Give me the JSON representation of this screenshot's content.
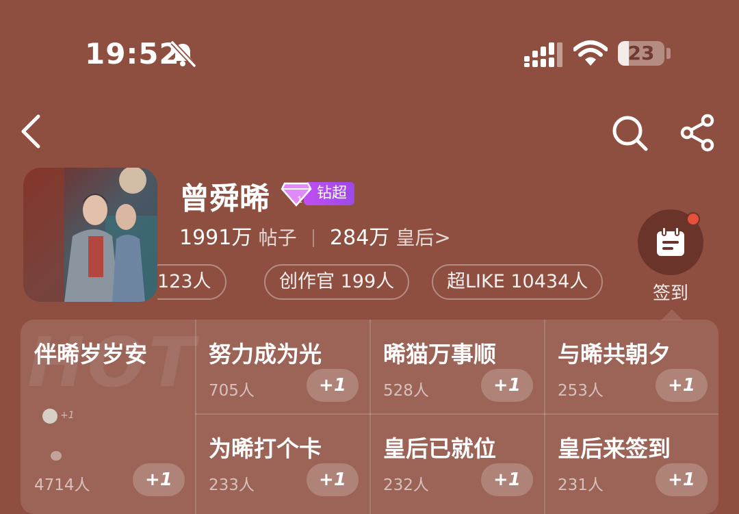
{
  "status_bar": {
    "time": "19:52",
    "battery_level": "23",
    "battery_fraction": 0.23,
    "icons": [
      "bell-muted-icon",
      "signal-icon",
      "wifi-icon",
      "battery-icon"
    ]
  },
  "nav": {
    "icons": [
      "back-chevron-icon",
      "search-icon",
      "share-icon"
    ]
  },
  "header": {
    "title": "曾舜晞",
    "badge_level": "1",
    "badge_label": "钻超",
    "posts_count": "1991万",
    "posts_label": "帖子",
    "members_count": "284万",
    "members_label": "皇后",
    "members_chevron": ">"
  },
  "tags": [
    {
      "label": "123人"
    },
    {
      "label": "创作官 199人"
    },
    {
      "label": "超LIKE 10434人"
    }
  ],
  "checkin": {
    "label": "签到",
    "accent_color": "#e8503a"
  },
  "grid": {
    "watermark": "HOT",
    "featured": {
      "title": "伴晞岁岁安",
      "count": "4714人",
      "button": "+1",
      "mini_plus": "+1"
    },
    "cells": [
      {
        "title": "努力成为光",
        "count": "705人",
        "button": "+1"
      },
      {
        "title": "晞猫万事顺",
        "count": "528人",
        "button": "+1"
      },
      {
        "title": "与晞共朝夕",
        "count": "253人",
        "button": "+1"
      },
      {
        "title": "为晞打个卡",
        "count": "233人",
        "button": "+1"
      },
      {
        "title": "皇后已就位",
        "count": "232人",
        "button": "+1"
      },
      {
        "title": "皇后来签到",
        "count": "231人",
        "button": "+1"
      }
    ]
  },
  "colors": {
    "background": "#8e4f40",
    "badge_purple": "#c14ff2"
  }
}
